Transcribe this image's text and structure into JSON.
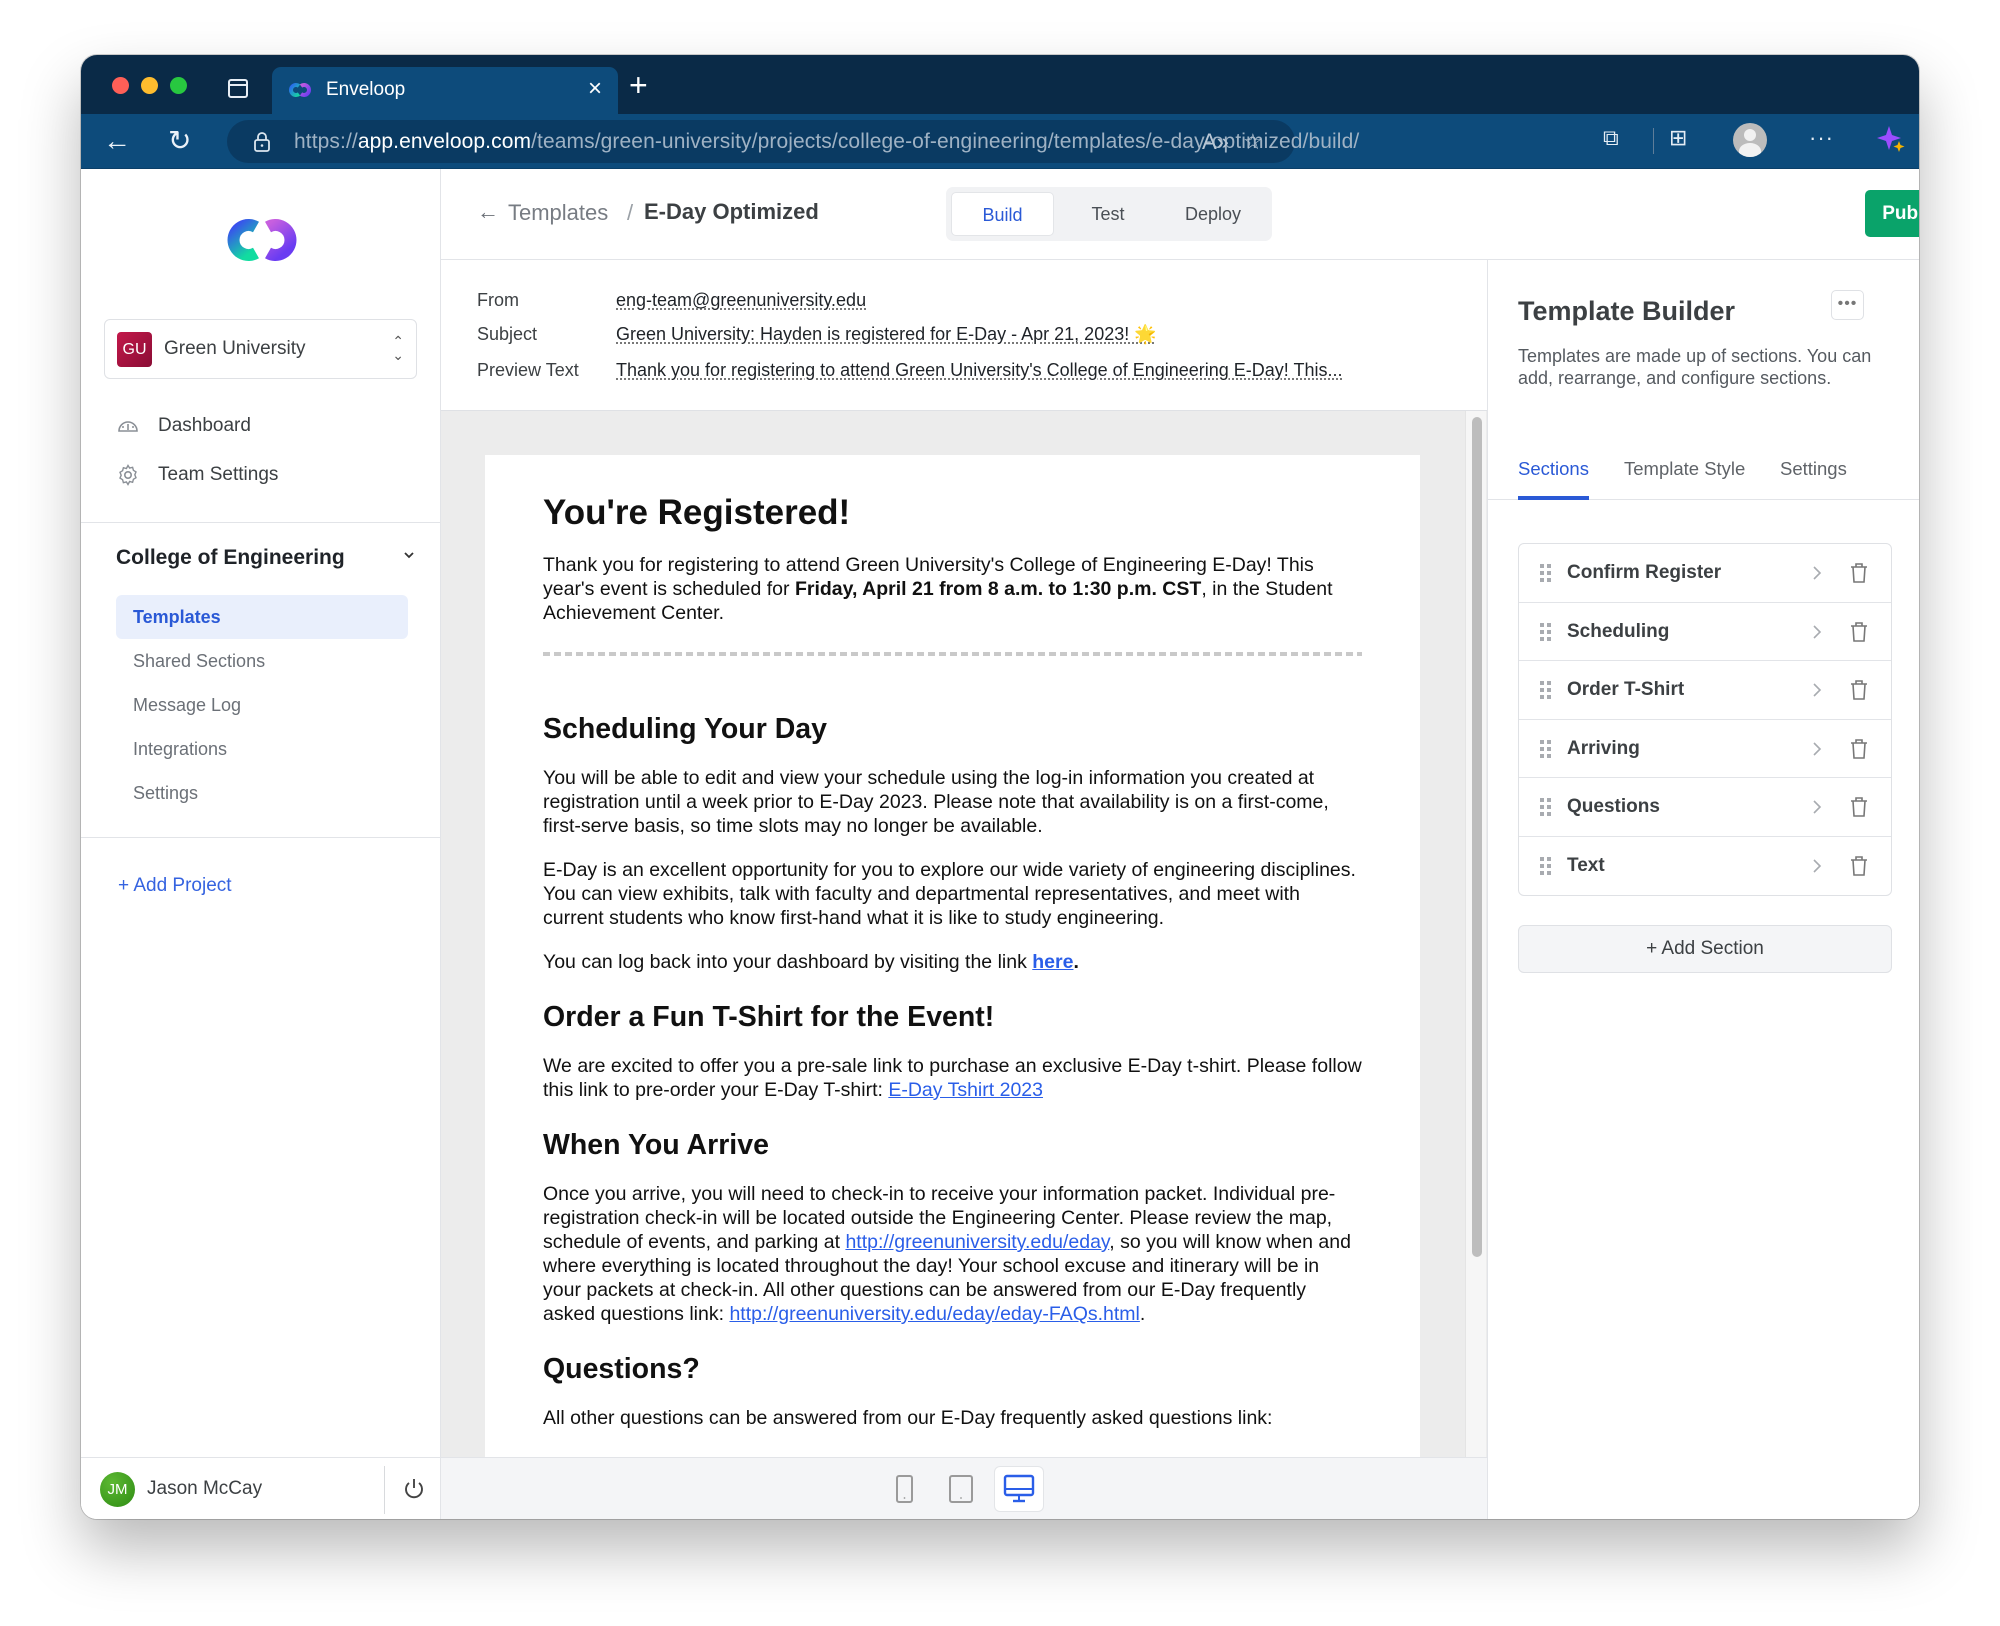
{
  "browser": {
    "tab_title": "Enveloop",
    "url_prefix": "https://",
    "url_host": "app.enveloop.com",
    "url_path": "/teams/green-university/projects/college-of-engineering/templates/e-day-optimized/build/"
  },
  "sidebar": {
    "team": {
      "initials": "GU",
      "name": "Green University"
    },
    "nav": [
      {
        "label": "Dashboard",
        "icon": "dashboard-gauge-icon"
      },
      {
        "label": "Team Settings",
        "icon": "gear-icon"
      }
    ],
    "project": {
      "title": "College of Engineering",
      "items": [
        {
          "label": "Templates",
          "active": true
        },
        {
          "label": "Shared Sections",
          "active": false
        },
        {
          "label": "Message Log",
          "active": false
        },
        {
          "label": "Integrations",
          "active": false
        },
        {
          "label": "Settings",
          "active": false
        }
      ]
    },
    "add_project": "+ Add Project",
    "user": {
      "initials": "JM",
      "name": "Jason McCay"
    }
  },
  "header": {
    "breadcrumb_parent": "Templates",
    "breadcrumb_sep": "/",
    "breadcrumb_current": "E-Day Optimized",
    "modes": [
      {
        "label": "Build",
        "active": true
      },
      {
        "label": "Test",
        "active": false
      },
      {
        "label": "Deploy",
        "active": false
      }
    ],
    "publish_label": "Publish"
  },
  "meta": {
    "from_label": "From",
    "from_value": "eng-team@greenuniversity.edu",
    "subject_label": "Subject",
    "subject_value": "Green University: Hayden is registered for E-Day - Apr 21, 2023! 🌟",
    "preview_label": "Preview Text",
    "preview_value": "Thank you for registering to attend Green University's College of Engineering E-Day! This..."
  },
  "email": {
    "h1": "You're Registered!",
    "intro_1": "Thank you for registering to attend Green University's College of Engineering E-Day! This year's event is scheduled for ",
    "intro_bold": "Friday, April 21 from 8 a.m. to 1:30 p.m. CST",
    "intro_2": ", in the Student Achievement Center.",
    "h2_schedule": "Scheduling Your Day",
    "schedule_p1": "You will be able to edit and view your schedule using the log-in information you created at registration until a week prior to E-Day 2023. Please note that availability is on a first-come, first-serve basis, so time slots may no longer be available.",
    "schedule_p2": "E-Day is an excellent opportunity for you to explore our wide variety of engineering disciplines. You can view exhibits, talk with faculty and departmental representatives, and meet with current students who know first-hand what it is like to study engineering.",
    "schedule_p3_pre": "You can log back into your dashboard by visiting the link ",
    "schedule_p3_link": "here",
    "schedule_p3_post": ".",
    "h2_tshirt": "Order a Fun T-Shirt for the Event!",
    "tshirt_p": "We are excited to offer you a pre-sale link to purchase an exclusive E-Day t-shirt. Please follow this link to pre-order your E-Day T-shirt: ",
    "tshirt_link": "E-Day Tshirt 2023",
    "h2_arrive": "When You Arrive",
    "arrive_p1": "Once you arrive, you will need to check-in to receive your information packet. Individual pre-registration check-in will be located outside the Engineering Center. Please review the map, schedule of events, and parking at ",
    "arrive_link1": "http://greenuniversity.edu/eday",
    "arrive_p2": ", so you will know when and where everything is located throughout the day! Your school excuse and itinerary will be in your packets at check-in. All other questions can be answered from our E-Day frequently asked questions link: ",
    "arrive_link2": "http://greenuniversity.edu/eday/eday-FAQs.html",
    "arrive_p3": ".",
    "h2_questions": "Questions?",
    "questions_p": "All other questions can be answered from our E-Day frequently asked questions link:"
  },
  "device_bar": [
    {
      "name": "mobile",
      "active": false
    },
    {
      "name": "tablet",
      "active": false
    },
    {
      "name": "desktop",
      "active": true
    }
  ],
  "panel": {
    "title": "Template Builder",
    "description": "Templates are made up of sections. You can add, rearrange, and configure sections.",
    "tabs": [
      {
        "label": "Sections",
        "active": true
      },
      {
        "label": "Template Style",
        "active": false
      },
      {
        "label": "Settings",
        "active": false
      }
    ],
    "sections": [
      {
        "label": "Confirm Register"
      },
      {
        "label": "Scheduling"
      },
      {
        "label": "Order T-Shirt"
      },
      {
        "label": "Arriving"
      },
      {
        "label": "Questions"
      },
      {
        "label": "Text"
      }
    ],
    "add_section": "+ Add Section"
  },
  "colors": {
    "accent": "#2a59d6",
    "publish": "#0aa36a",
    "chrome_dark": "#0a2a47",
    "chrome": "#0d4b7b"
  }
}
